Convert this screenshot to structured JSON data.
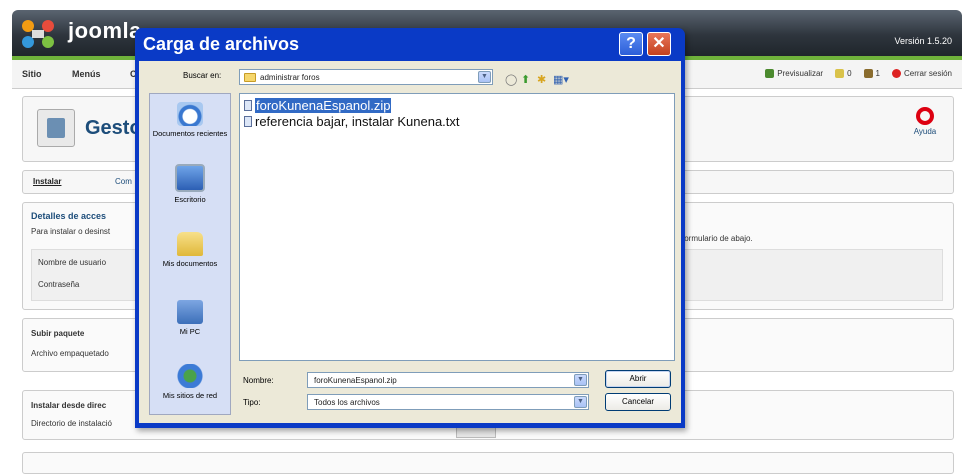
{
  "joomla": {
    "site_title": "joomla",
    "version": "Versión 1.5.20",
    "menu": [
      "Sitio",
      "Menús",
      "C"
    ],
    "right_links": [
      {
        "label": "Previsualizar",
        "icon": "preview-icon"
      },
      {
        "label": "0",
        "icon": "messages-icon"
      },
      {
        "label": "1",
        "icon": "users-icon"
      },
      {
        "label": "Cerrar sesión",
        "icon": "logout-icon"
      }
    ],
    "panel_title": "Gesto",
    "help_label": "Ayuda",
    "tabs": {
      "active": "Instalar",
      "other": "Com"
    },
    "ftp": {
      "legend": "Detalles de acces",
      "intro": "Para instalar o desinst",
      "intro_right": "formulario de abajo.",
      "username_label": "Nombre de usuario",
      "password_label": "Contraseña"
    },
    "upload": {
      "title": "Subir paquete",
      "file_label": "Archivo empaquetado"
    },
    "install_dir": {
      "title": "Instalar desde direc",
      "dir_label": "Directorio de instalació"
    }
  },
  "dialog": {
    "title": "Carga de archivos",
    "look_in_label": "Buscar en:",
    "look_in_value": "administrar foros",
    "places": [
      {
        "label": "Documentos recientes",
        "icon": "recent-documents-icon"
      },
      {
        "label": "Escritorio",
        "icon": "desktop-icon"
      },
      {
        "label": "Mis documentos",
        "icon": "my-documents-icon"
      },
      {
        "label": "Mi PC",
        "icon": "my-computer-icon"
      },
      {
        "label": "Mis sitios de red",
        "icon": "network-places-icon"
      }
    ],
    "files": [
      {
        "name": "foroKunenaEspanol.zip",
        "selected": true
      },
      {
        "name": "referencia bajar, instalar Kunena.txt",
        "selected": false
      }
    ],
    "name_label": "Nombre:",
    "name_value": "foroKunenaEspanol.zip",
    "type_label": "Tipo:",
    "type_value": "Todos los archivos",
    "open_button": "Abrir",
    "cancel_button": "Cancelar"
  }
}
